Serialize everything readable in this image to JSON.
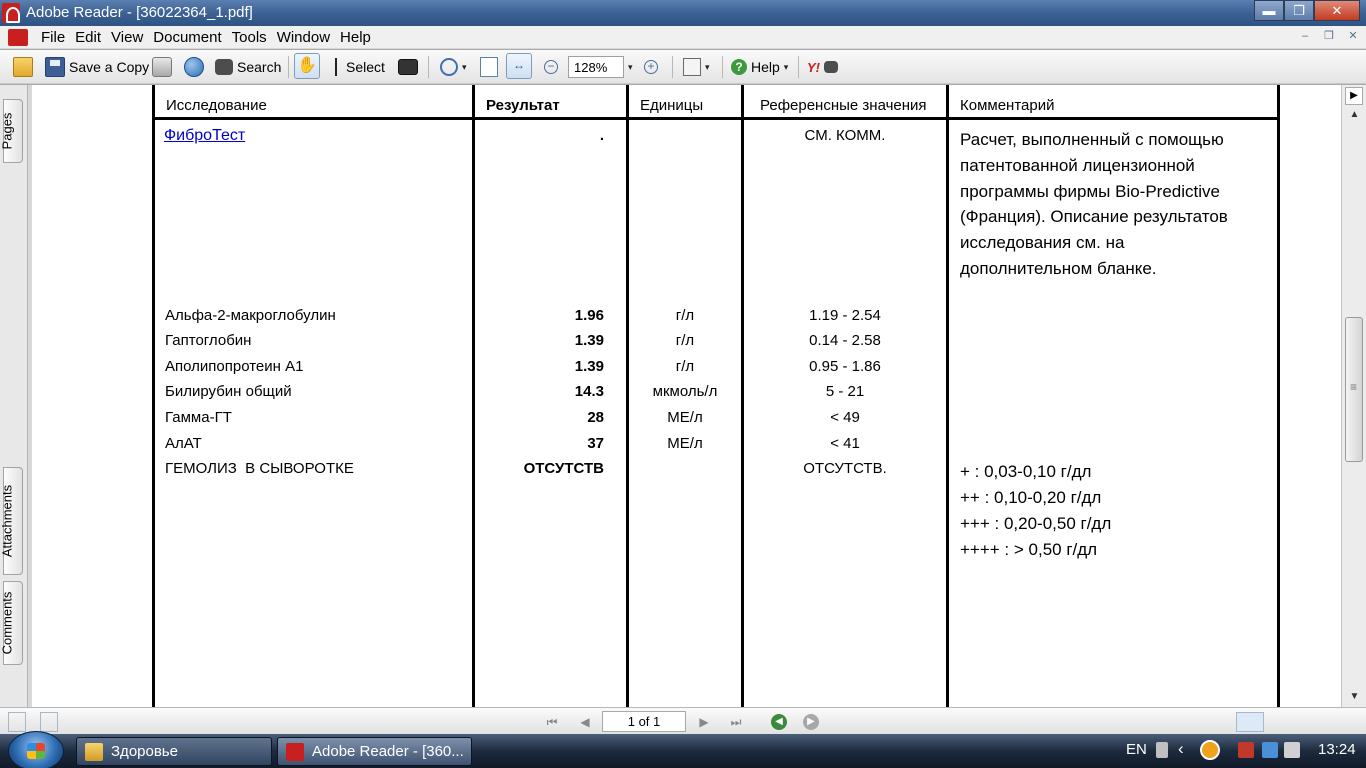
{
  "window": {
    "title": "Adobe Reader - [36022364_1.pdf]",
    "min_glyph": "▬",
    "max_glyph": "❐",
    "close_glyph": "✕"
  },
  "menu": {
    "items": [
      "File",
      "Edit",
      "View",
      "Document",
      "Tools",
      "Window",
      "Help"
    ],
    "mdi": {
      "min": "–",
      "restore": "❐",
      "close": "✕"
    }
  },
  "toolbar": {
    "save_copy": "Save a Copy",
    "search": "Search",
    "select": "Select",
    "zoom": "128%",
    "help": "Help",
    "yahoo": "Y!",
    "hand_glyph": "✋",
    "fitwidth_glyph": "↔",
    "zoom_out_glyph": "−",
    "zoom_in_glyph": "+",
    "caret": "▾"
  },
  "side_tabs": {
    "pages": "Pages",
    "attachments": "Attachments",
    "comments": "Comments"
  },
  "table": {
    "headers": {
      "test": "Исследование",
      "result": "Результат",
      "units": "Единицы",
      "reference": "Референсные значения",
      "comment": "Комментарий"
    },
    "fibrotest": {
      "name": "ФиброТест",
      "result": ".",
      "reference": "СМ. КОММ.",
      "comment": "Расчет, выполненный с помощью патентованной лицензионной программы фирмы Bio-Predictive (Франция). Описание результатов исследования см. на дополнительном бланке."
    },
    "rows": [
      {
        "name": "Альфа-2-макроглобулин",
        "result": "1.96",
        "units": "г/л",
        "reference": "1.19 - 2.54"
      },
      {
        "name": "Гаптоглобин",
        "result": "1.39",
        "units": "г/л",
        "reference": "0.14 - 2.58"
      },
      {
        "name": "Аполипопротеин А1",
        "result": "1.39",
        "units": "г/л",
        "reference": "0.95 - 1.86"
      },
      {
        "name": "Билирубин общий",
        "result": "14.3",
        "units": "мкмоль/л",
        "reference": "5 - 21"
      },
      {
        "name": "Гамма-ГТ",
        "result": "28",
        "units": "МЕ/л",
        "reference": "< 49"
      },
      {
        "name": "АлАТ",
        "result": "37",
        "units": "МЕ/л",
        "reference": "< 41"
      }
    ],
    "hemolysis": {
      "name": "ГЕМОЛИЗ  В СЫВОРОТКЕ",
      "result": "ОТСУТСТВ",
      "reference": "ОТСУТСТВ.",
      "comment_lines": [
        "+ : 0,03-0,10 г/дл",
        "++ : 0,10-0,20 г/дл",
        "+++ : 0,20-0,50 г/дл",
        "++++ : > 0,50 г/дл"
      ]
    }
  },
  "scroll": {
    "up": "▲",
    "down": "▼",
    "panel_toggle": "▶"
  },
  "statusbar": {
    "page_indicator": "1 of 1",
    "first": "⏮",
    "prev": "◀",
    "next": "▶",
    "last": "⏭",
    "back": "◀",
    "forward": "▶"
  },
  "taskbar": {
    "task1": "Здоровье",
    "task2": "Adobe Reader - [360...",
    "lang": "EN",
    "time": "13:24",
    "tray_arrow": "‹"
  },
  "colors": {
    "title_bar": "#3a5f92",
    "link": "#0000cc",
    "acrobat_red": "#c8201f"
  }
}
